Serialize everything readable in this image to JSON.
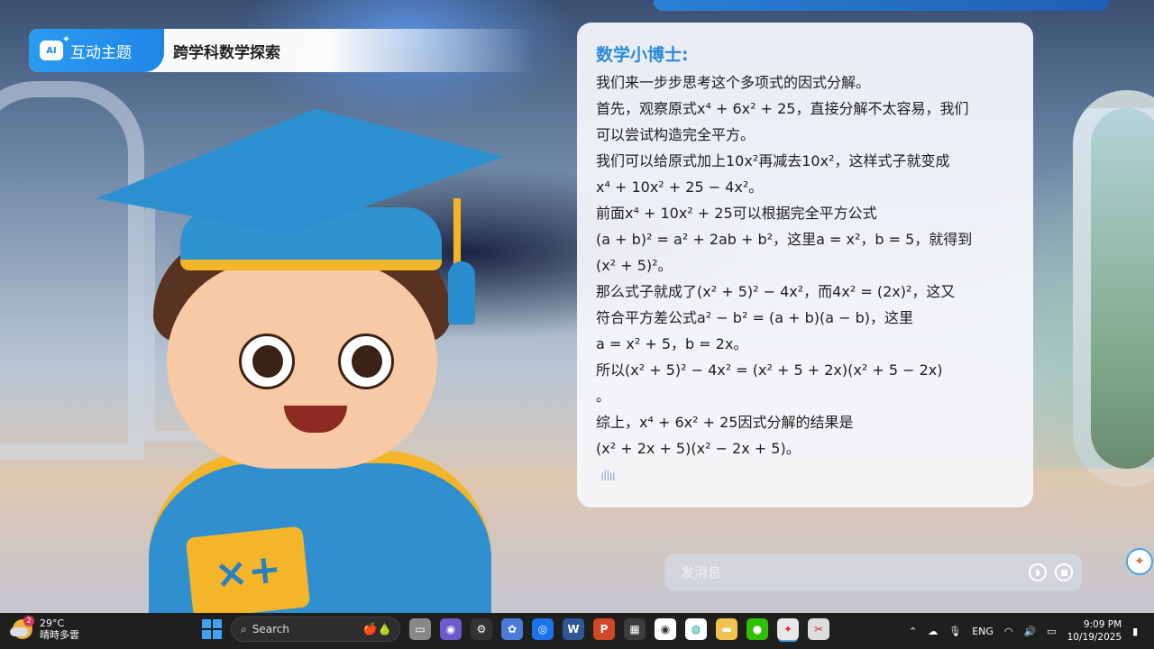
{
  "header": {
    "badge_icon": "AI",
    "badge_label": "互动主题",
    "title": "跨学科数学探索"
  },
  "chat": {
    "assistant_name": "数学小博士:",
    "lines": [
      "我们来一步步思考这个多项式的因式分解。",
      "首先，观察原式x⁴ + 6x² + 25，直接分解不太容易，我们",
      "可以尝试构造完全平方。",
      "我们可以给原式加上10x²再减去10x²，这样式子就变成",
      "x⁴ + 10x² + 25 − 4x²。",
      "前面x⁴ + 10x² + 25可以根据完全平方公式",
      "(a + b)² = a² + 2ab + b²，这里a = x²，b = 5，就得到",
      "(x² + 5)²。",
      "那么式子就成了(x² + 5)² − 4x²，而4x² = (2x)²，这又",
      "符合平方差公式a² − b² = (a + b)(a − b)，这里",
      "a = x² + 5，b = 2x。",
      "所以(x² + 5)² − 4x² = (x² + 5 + 2x)(x² + 5 − 2x)",
      "。",
      "综上，x⁴ + 6x² + 25因式分解的结果是",
      "(x² + 2x + 5)(x² − 2x + 5)。"
    ],
    "audio_icon": "audio-wave-icon"
  },
  "input": {
    "placeholder": "发消息"
  },
  "taskbar": {
    "weather": {
      "badge": "2",
      "temp": "29°C",
      "desc": "晴時多雲"
    },
    "search_label": "Search",
    "language": "ENG",
    "time": "9:09 PM",
    "date": "10/19/2025"
  }
}
